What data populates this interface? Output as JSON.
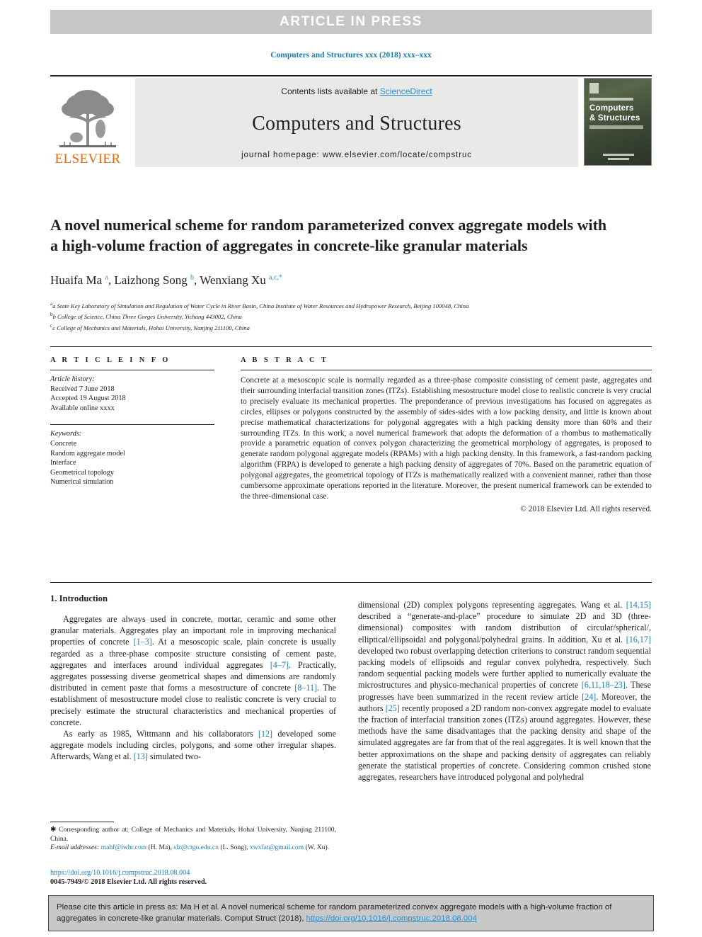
{
  "banner": {
    "text": "ARTICLE  IN  PRESS",
    "background": "#c6c6c6",
    "text_color": "#ffffff"
  },
  "running_head": "Computers and Structures xxx (2018) xxx–xxx",
  "masthead": {
    "contents_prefix": "Contents lists available at ",
    "sciencedirect": "ScienceDirect",
    "journal_title": "Computers and Structures",
    "homepage": "journal homepage: www.elsevier.com/locate/compstruc",
    "publisher_logo_text": "ELSEVIER",
    "publisher_logo_color": "#eb6608",
    "cover": {
      "line1": "Computers",
      "line2": "& Structures"
    }
  },
  "article": {
    "title": "A novel numerical scheme for random parameterized convex aggregate models with a high-volume fraction of aggregates in concrete-like granular materials",
    "authors_html": "Huaifa Ma <sup>a</sup>, Laizhong Song <sup>b</sup>, Wenxiang Xu <sup>a,c,</sup><sup>*</sup>",
    "affiliations": [
      "a State Key Laboratory of Simulation and Regulation of Water Cycle in River Basin, China Institute of Water Resources and Hydropower Research, Beijing 100048, China",
      "b College of Science, China Three Gorges University, Yichang 443002, China",
      "c College of Mechanics and Materials, Hohai University, Nanjing 211100, China"
    ]
  },
  "article_info": {
    "heading": "A R T I C L E   I N F O",
    "history_label": "Article history:",
    "history": [
      "Received 7 June 2018",
      "Accepted 19 August 2018",
      "Available online xxxx"
    ],
    "keywords_label": "Keywords:",
    "keywords": [
      "Concrete",
      "Random aggregate model",
      "Interface",
      "Geometrical topology",
      "Numerical simulation"
    ]
  },
  "abstract": {
    "heading": "A B S T R A C T",
    "body": "Concrete at a mesoscopic scale is normally regarded as a three-phase composite consisting of cement paste, aggregates and their surrounding interfacial transition zones (ITZs). Establishing mesostructure model close to realistic concrete is very crucial to precisely evaluate its mechanical properties. The preponderance of previous investigations has focused on aggregates as circles, ellipses or polygons constructed by the assembly of sides-sides with a low packing density, and little is known about precise mathematical characterizations for polygonal aggregates with a high packing density more than 60% and their surrounding ITZs. In this work, a novel numerical framework that adopts the deformation of a rhombus to mathematically provide a parametric equation of convex polygon characterizing the geometrical morphology of aggregates, is proposed to generate random polygonal aggregate models (RPAMs) with a high packing density. In this framework, a fast-random packing algorithm (FRPA) is developed to generate a high packing density of aggregates of 70%. Based on the parametric equation of polygonal aggregates, the geometrical topology of ITZs is mathematically realized with a convenient manner, rather than those cumbersome approximate operations reported in the literature. Moreover, the present numerical framework can be extended to the three-dimensional case.",
    "copyright": "© 2018 Elsevier Ltd. All rights reserved."
  },
  "body": {
    "section_title": "1. Introduction",
    "left_col_html": "<p>Aggregates are always used in concrete, mortar, ceramic and some other granular materials. Aggregates play an important role in improving mechanical properties of concrete <span class=\"ref\">[1–3]</span>. At a mesoscopic scale, plain concrete is usually regarded as a three-phase composite structure consisting of cement paste, aggregates and interfaces around individual aggregates <span class=\"ref\">[4–7]</span>. Practically, aggregates possessing diverse geometrical shapes and dimensions are randomly distributed in cement paste that forms a mesostructure of concrete <span class=\"ref\">[8–11]</span>. The establishment of mesostructure model close to realistic concrete is very crucial to precisely estimate the structural characteristics and mechanical properties of concrete.</p><p>As early as 1985, Wittmann and his collaborators <span class=\"ref\">[12]</span> developed some aggregate models including circles, polygons, and some other irregular shapes. Afterwards, Wang et al. <span class=\"ref\">[13]</span> simulated two-</p>",
    "right_col_html": "<p style=\"text-indent:0\">dimensional (2D) complex polygons representing aggregates. Wang et al. <span class=\"ref\">[14,15]</span> described a &ldquo;generate-and-place&rdquo; procedure to simulate 2D and 3D (three-dimensional) composites with random distribution of circular/spherical/, elliptical/ellipsoidal and polygonal/polyhedral grains. In addition, Xu et al. <span class=\"ref\">[16,17]</span> developed two robust overlapping detection criterions to construct random sequential packing models of ellipsoids and regular convex polyhedra, respectively. Such random sequential packing models were further applied to numerically evaluate the microstructures and physico-mechanical properties of concrete <span class=\"ref\">[6,11,18–23]</span>. These progresses have been summarized in the recent review article <span class=\"ref\">[24]</span>. Moreover, the authors <span class=\"ref\">[25]</span> recently proposed a 2D random non-convex aggregate model to evaluate the fraction of interfacial transition zones (ITZs) around aggregates. However, these methods have the same disadvantages that the packing density and shape of the simulated aggregates are far from that of the real aggregates. It is well known that the better approximations on the shape and packing density of aggregates can reliably generate the statistical properties of concrete. Considering common crushed stone aggregates, researchers have introduced polygonal and polyhedral</p>"
  },
  "footnotes": {
    "corresponding_html": "<span class=\"star\">&#10033;</span> Corresponding author at: College of Mechanics and Materials, Hohai University, Nanjing 211100, China.",
    "emails_html": "<span class=\"em\">E-mail addresses:</span> <span class=\"link\">mahf@iwhr.com</span> (H. Ma), <span class=\"link\">slz@ctgu.edu.cn</span> (L. Song), <span class=\"link\">xwxfat@gmail.com</span> (W. Xu)."
  },
  "doi_block": {
    "doi": "https://doi.org/10.1016/j.compstruc.2018.08.004",
    "issn_line": "0045-7949/© 2018 Elsevier Ltd. All rights reserved."
  },
  "cite_box": {
    "prefix": "Please cite this article in press as: Ma H et al. A novel numerical scheme for random parameterized convex aggregate models with a high-volume fraction of aggregates in concrete-like granular materials. Comput Struct (2018), ",
    "doi": "https://doi.org/10.1016/j.compstruc.2018.08.004"
  }
}
